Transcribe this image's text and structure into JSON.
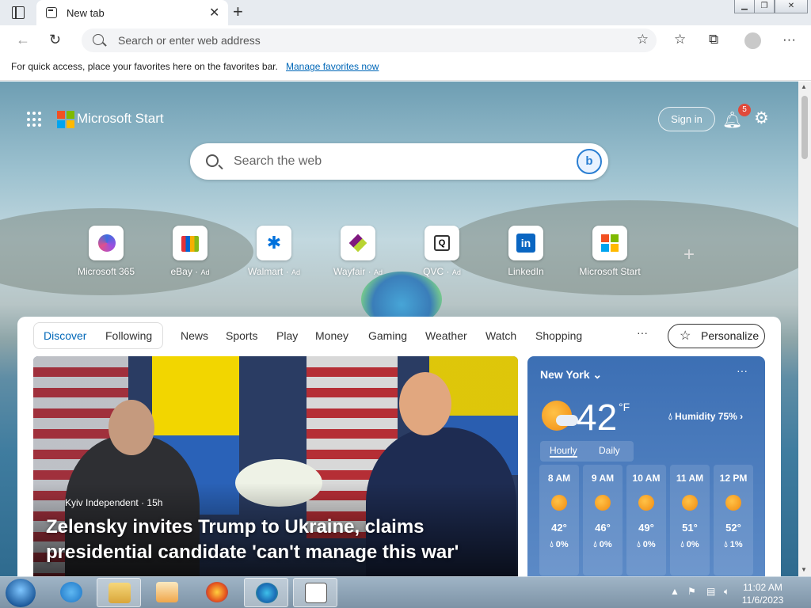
{
  "browser": {
    "tab_title": "New tab",
    "address_placeholder": "Search or enter web address",
    "favbar_text": "For quick access, place your favorites here on the favorites bar.",
    "favbar_link": "Manage favorites now"
  },
  "start": {
    "brand": "Microsoft Start",
    "sign_in": "Sign in",
    "notification_count": "5",
    "search_placeholder": "Search the web",
    "quick_links": [
      {
        "label": "Microsoft 365",
        "ad": ""
      },
      {
        "label": "eBay",
        "ad": "Ad"
      },
      {
        "label": "Walmart",
        "ad": "Ad"
      },
      {
        "label": "Wayfair",
        "ad": "Ad"
      },
      {
        "label": "QVC",
        "ad": "Ad"
      },
      {
        "label": "LinkedIn",
        "ad": ""
      },
      {
        "label": "Microsoft Start",
        "ad": ""
      }
    ]
  },
  "feed": {
    "tabs": [
      "Discover",
      "Following",
      "News",
      "Sports",
      "Play",
      "Money",
      "Gaming",
      "Weather",
      "Watch",
      "Shopping"
    ],
    "more": "···",
    "personalize": "Personalize",
    "hero": {
      "source": "Kyiv Independent · 15h",
      "headline": "Zelensky invites Trump to Ukraine, claims presidential candidate 'can't manage this war'"
    }
  },
  "weather": {
    "city": "New York",
    "temp": "42",
    "unit": "°F",
    "humidity": "Humidity 75%",
    "tabs": [
      "Hourly",
      "Daily"
    ],
    "hourly": [
      {
        "time": "8 AM",
        "temp": "42°",
        "precip": "0%"
      },
      {
        "time": "9 AM",
        "temp": "46°",
        "precip": "0%"
      },
      {
        "time": "10 AM",
        "temp": "49°",
        "precip": "0%"
      },
      {
        "time": "11 AM",
        "temp": "51°",
        "precip": "0%"
      },
      {
        "time": "12 PM",
        "temp": "52°",
        "precip": "1%"
      }
    ]
  },
  "taskbar": {
    "time": "11:02 AM",
    "date": "11/6/2023"
  }
}
